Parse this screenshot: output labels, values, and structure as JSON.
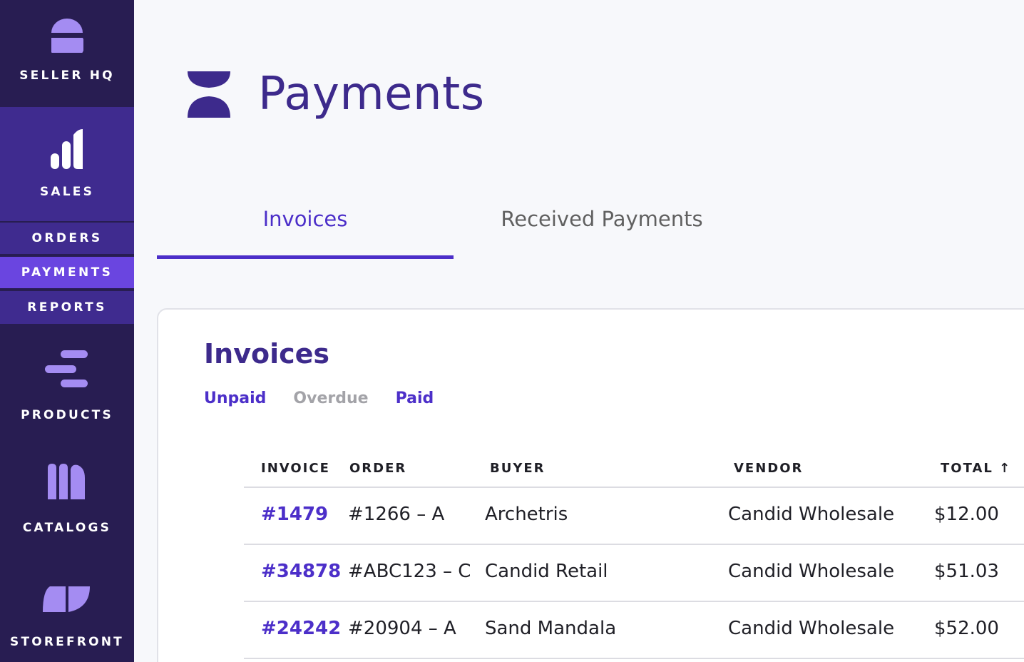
{
  "sidebar": {
    "brand_label": "SELLER HQ",
    "items": [
      {
        "label": "SALES",
        "icon": "bar-chart-icon"
      },
      {
        "label": "PRODUCTS",
        "icon": "products-icon"
      },
      {
        "label": "CATALOGS",
        "icon": "catalogs-icon"
      },
      {
        "label": "STOREFRONT",
        "icon": "storefront-icon"
      }
    ],
    "subnav": [
      {
        "label": "ORDERS",
        "active": false
      },
      {
        "label": "PAYMENTS",
        "active": true
      },
      {
        "label": "REPORTS",
        "active": false
      }
    ]
  },
  "header": {
    "title": "Payments",
    "icon": "payments-icon"
  },
  "tabs": [
    {
      "label": "Invoices",
      "active": true
    },
    {
      "label": "Received Payments",
      "active": false
    }
  ],
  "card": {
    "title": "Invoices",
    "filters": [
      {
        "label": "Unpaid",
        "active": true
      },
      {
        "label": "Overdue",
        "active": false
      },
      {
        "label": "Paid",
        "active": true
      }
    ]
  },
  "table": {
    "columns": [
      "INVOICE",
      "ORDER",
      "BUYER",
      "VENDOR",
      "TOTAL ↑"
    ],
    "rows": [
      {
        "invoice": "#1479",
        "order": "#1266 – A",
        "buyer": "Archetris",
        "vendor": "Candid Wholesale",
        "total": "$12.00"
      },
      {
        "invoice": "#34878",
        "order": "#ABC123 – C",
        "buyer": "Candid Retail",
        "vendor": "Candid Wholesale",
        "total": "$51.03"
      },
      {
        "invoice": "#24242",
        "order": "#20904 – A",
        "buyer": "Sand Mandala",
        "vendor": "Candid Wholesale",
        "total": "$52.00"
      }
    ]
  },
  "colors": {
    "sidebar_bg": "#281d52",
    "sidebar_section": "#3f2b8f",
    "sidebar_active": "#6a45e0",
    "accent": "#4c2fc9",
    "icon_light": "#a48cf2",
    "title": "#3d2a8c"
  }
}
